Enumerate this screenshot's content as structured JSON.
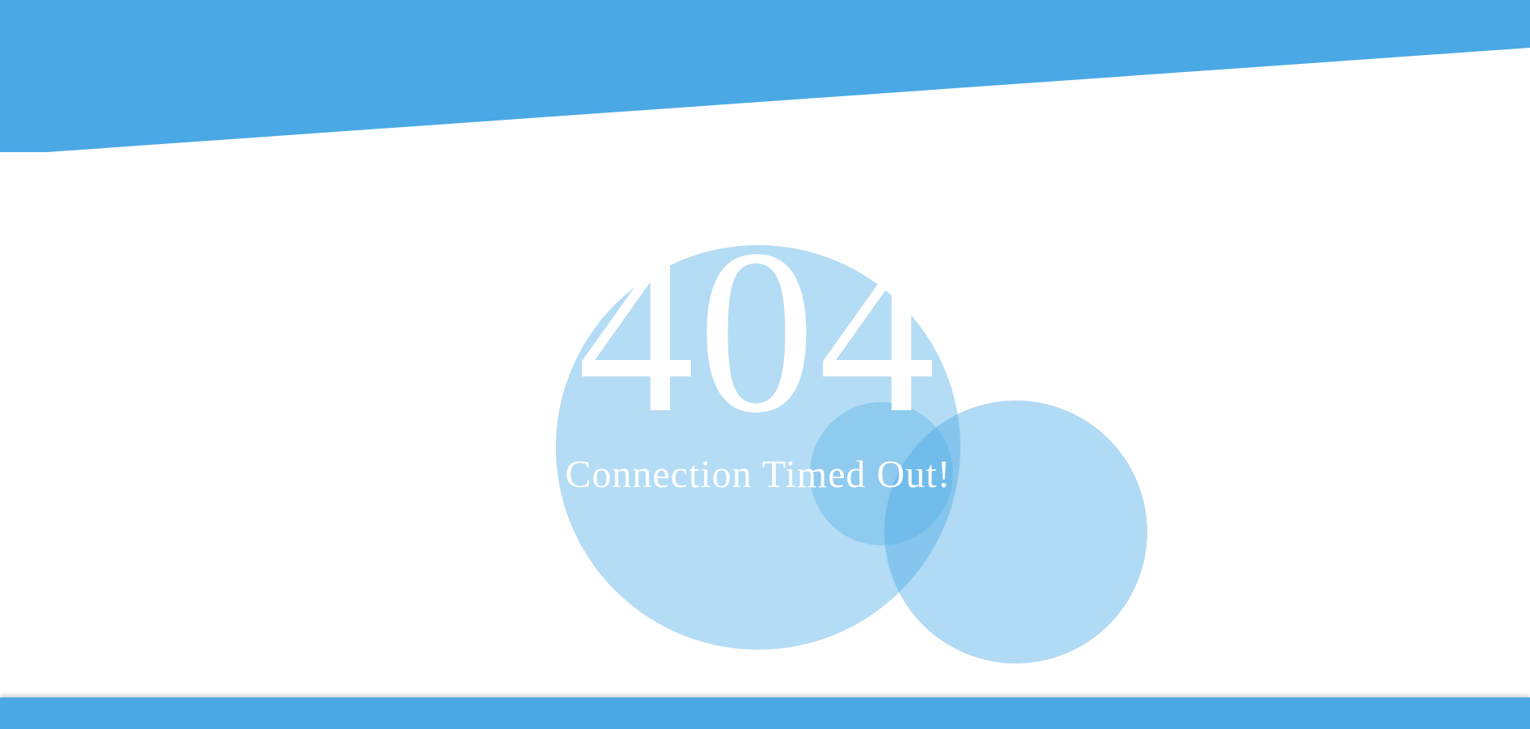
{
  "colors": {
    "accent": "#4aa9e5",
    "background": "#ffffff",
    "text": "#ffffff"
  },
  "error": {
    "code": "404",
    "message": "Connection Timed Out!"
  }
}
